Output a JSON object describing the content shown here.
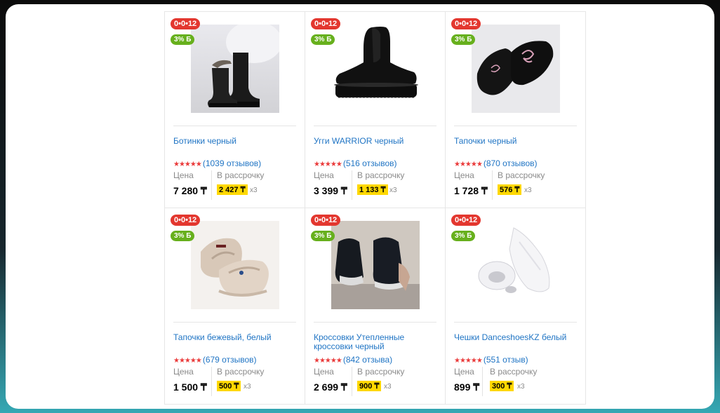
{
  "products": [
    {
      "timer": "0•0•12",
      "bonus": "3% Б",
      "title": "Ботинки черный",
      "stars": "★★★★★",
      "reviews": "(1039 отзывов)",
      "price_label": "Цена",
      "price": "7 280 ₸",
      "installment_label": "В рассрочку",
      "installment": "2 427 ₸",
      "multiplier": "x3",
      "image": "boots-photo"
    },
    {
      "timer": "0•0•12",
      "bonus": "3% Б",
      "title": "Угги WARRIOR черный",
      "stars": "★★★★★",
      "reviews": "(516 отзывов)",
      "price_label": "Цена",
      "price": "3 399 ₸",
      "installment_label": "В рассрочку",
      "installment": "1 133 ₸",
      "multiplier": "x3",
      "image": "ugg-photo"
    },
    {
      "timer": "0•0•12",
      "bonus": "3% Б",
      "title": "Тапочки черный",
      "stars": "★★★★★",
      "reviews": "(870 отзывов)",
      "price_label": "Цена",
      "price": "1 728 ₸",
      "installment_label": "В рассрочку",
      "installment": "576 ₸",
      "multiplier": "x3",
      "image": "slippers-black-photo"
    },
    {
      "timer": "0•0•12",
      "bonus": "3% Б",
      "title": "Тапочки бежевый, белый",
      "stars": "★★★★★",
      "reviews": "(679 отзывов)",
      "price_label": "Цена",
      "price": "1 500 ₸",
      "installment_label": "В рассрочку",
      "installment": "500 ₸",
      "multiplier": "x3",
      "image": "slippers-beige-photo"
    },
    {
      "timer": "0•0•12",
      "bonus": "3% Б",
      "title": "Кроссовки Утепленные кроссовки черный",
      "stars": "★★★★★",
      "reviews": "(842 отзыва)",
      "price_label": "Цена",
      "price": "2 699 ₸",
      "installment_label": "В рассрочку",
      "installment": "900 ₸",
      "multiplier": "x3",
      "image": "sneakers-photo"
    },
    {
      "timer": "0•0•12",
      "bonus": "3% Б",
      "title": "Чешки DanceshoesKZ белый",
      "stars": "★★★★★",
      "reviews": "(551 отзыв)",
      "price_label": "Цена",
      "price": "899 ₸",
      "installment_label": "В рассрочку",
      "installment": "300 ₸",
      "multiplier": "x3",
      "image": "ballet-shoes-photo"
    }
  ]
}
